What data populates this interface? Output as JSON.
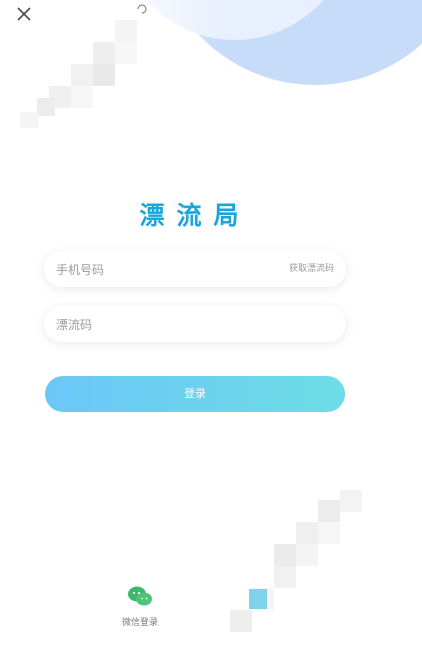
{
  "header": {
    "close_icon": "close-icon",
    "refresh_icon": "refresh-icon"
  },
  "app": {
    "title": "漂流局",
    "accent_color": "#1aa6d9"
  },
  "form": {
    "phone": {
      "placeholder": "手机号码",
      "value": ""
    },
    "get_code_label": "获取漂流码",
    "code": {
      "placeholder": "漂流码",
      "value": ""
    },
    "login_label": "登录",
    "login_gradient": [
      "#6cc6f7",
      "#6cdde5"
    ]
  },
  "third_party": {
    "wechat": {
      "label": "微信登录",
      "icon": "wechat-icon",
      "color": "#3bb86b"
    },
    "other": {
      "label": "",
      "icon": "app-icon",
      "color": "#7fd4ec"
    }
  }
}
